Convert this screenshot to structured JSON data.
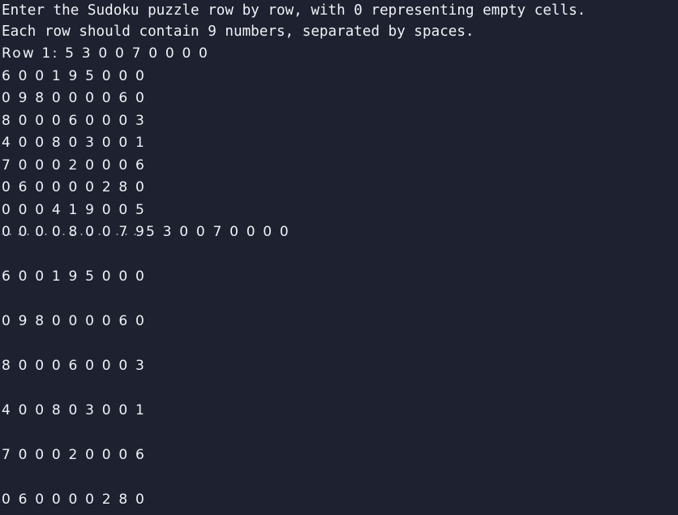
{
  "terminal": {
    "lines": [
      "Enter the Sudoku puzzle row by row, with 0 representing empty cells.",
      "Each row should contain 9 numbers, separated by spaces.",
      "Row 1: 5 3 0 0 7 0 0 0 0",
      "6 0 0 1 9 5 0 0 0",
      "0 9 8 0 0 0 0 6 0",
      "8 0 0 0 6 0 0 0 3",
      "4 0 0 8 0 3 0 0 1",
      "7 0 0 0 2 0 0 0 6",
      "0 6 0 0 0 0 2 8 0",
      "0 0 0 4 1 9 0 0 5",
      "0 0 0 0 8 0 0 7 95 3 0 0 7 0 0 0 0",
      "6 0 0 1 9 5 0 0 0",
      "0 9 8 0 0 0 0 6 0",
      "8 0 0 0 6 0 0 0 3",
      "4 0 0 8 0 3 0 0 1",
      "7 0 0 0 2 0 0 0 6",
      "0 6 0 0 0 0 2 8 0"
    ]
  }
}
